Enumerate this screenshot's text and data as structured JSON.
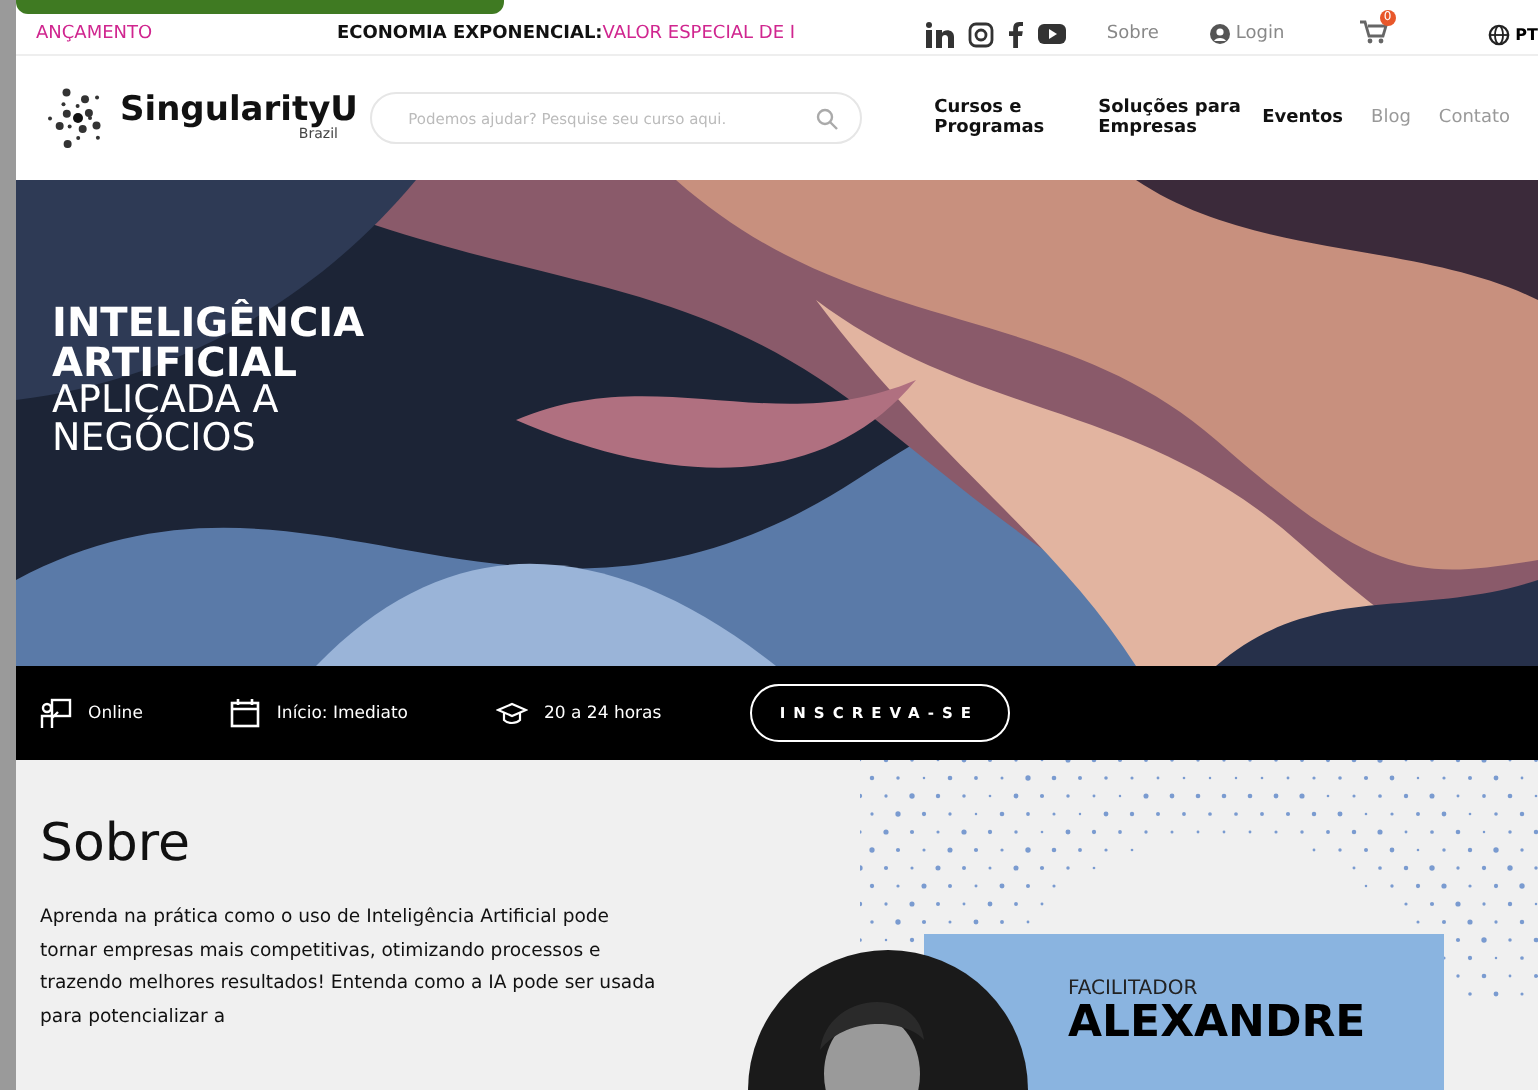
{
  "top_bar": {
    "launch": "ANÇAMENTO",
    "ticker": [
      {
        "text": "ECONOMIA EXPONENCIAL:",
        "kind": "plain"
      },
      {
        "text": "VALOR ESPECIAL DE I",
        "kind": "highlight"
      }
    ],
    "links": [
      "Sobre"
    ],
    "login": "Login",
    "cart_count": "0",
    "language": "PT"
  },
  "header": {
    "logo": {
      "name": "SingularityU",
      "sub": "Brazil"
    },
    "search": {
      "placeholder": "Podemos ajudar? Pesquise seu curso aqui."
    },
    "nav": [
      {
        "label": "Cursos e Programas",
        "selected": true
      },
      {
        "label": "Soluções para Empresas",
        "selected": true
      },
      {
        "label": "Eventos",
        "selected": true
      },
      {
        "label": "Blog",
        "selected": false
      },
      {
        "label": "Contato",
        "selected": false
      }
    ]
  },
  "hero": {
    "kind": "picture",
    "title_bold": [
      "INTELIGÊNCIA",
      "ARTIFICIAL"
    ],
    "title_light": [
      "APLICADA A",
      "NEGÓCIOS"
    ]
  },
  "info_bar": {
    "items": [
      {
        "kind": "online",
        "text": "Online"
      },
      {
        "kind": "calendar",
        "text": "Início: Imediato"
      },
      {
        "kind": "hours",
        "text": "20 a 24 horas"
      }
    ],
    "button": "INSCREVA-SE"
  },
  "about": {
    "title": "Sobre",
    "text": "Aprenda na prática como o uso de Inteligência Artificial pode tornar empresas mais competitivas, otimizando processos e trazendo melhores resultados! Entenda como a IA pode ser usada para potencializar a"
  },
  "facilitator": {
    "role": "FACILITADOR",
    "name": "ALEXANDRE"
  }
}
